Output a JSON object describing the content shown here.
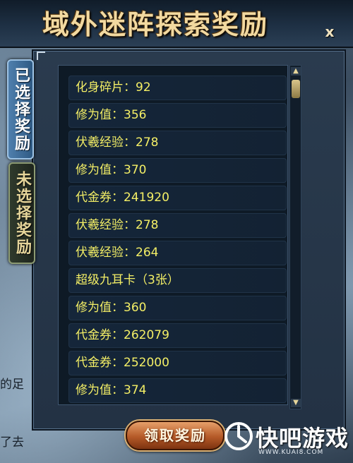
{
  "window": {
    "title": "域外迷阵探索奖励",
    "close_label": "x"
  },
  "tabs": [
    {
      "label": "已选择奖励",
      "selected": true
    },
    {
      "label": "未选择奖励",
      "selected": false
    }
  ],
  "rewards": [
    "化身碎片：92",
    "修为值：356",
    "伏羲经验：278",
    "修为值：370",
    "代金券：241920",
    "伏羲经验：278",
    "伏羲经验：264",
    "超级九耳卡（3张）",
    "修为值：360",
    "代金券：262079",
    "代金券：252000",
    "修为值：374"
  ],
  "claim_button": {
    "label": "领取奖励"
  },
  "edge_text": {
    "line1": "的足",
    "line2": "了去"
  },
  "watermark": {
    "name": "快吧游戏",
    "url": "WWW.KUAI8.COM"
  },
  "colors": {
    "reward_text": "#f4ef66",
    "title_text": "#f2d9a0",
    "tab_selected": "#4f7fad"
  }
}
